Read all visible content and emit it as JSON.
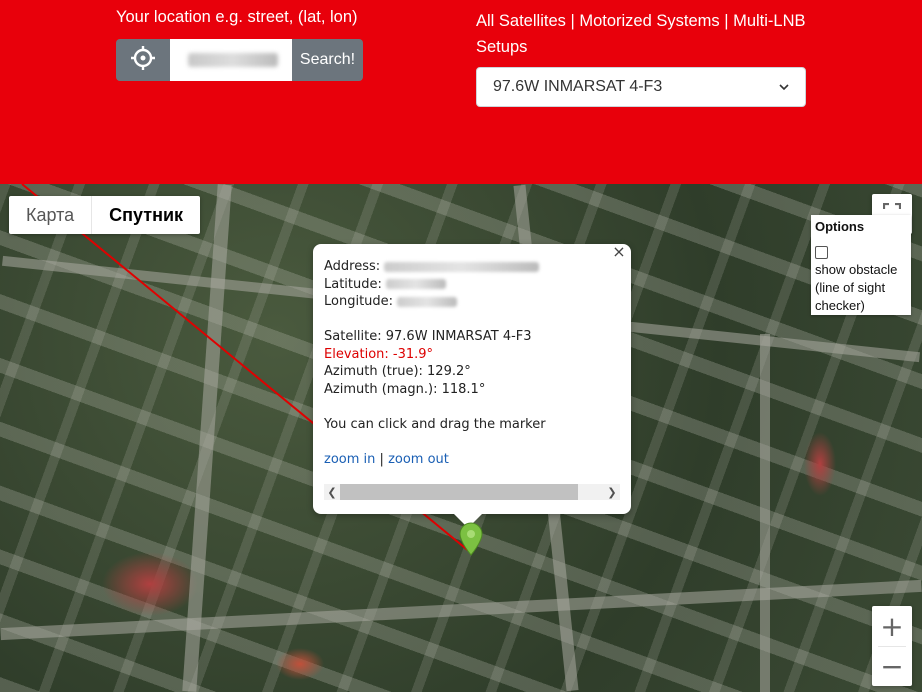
{
  "header": {
    "location_label": "Your location e.g. street, (lat, lon)",
    "search_placeholder": "",
    "search_button": "Search!",
    "satellite_links": "All Satellites | Motorized Systems | Multi-LNB Setups",
    "satellite_selected": "97.6W INMARSAT 4-F3",
    "colors": {
      "header_bg": "#e8000b",
      "button_bg": "#6c757d"
    }
  },
  "map": {
    "map_types": [
      "Карта",
      "Спутник"
    ],
    "active_map_type": "Спутник",
    "options": {
      "title": "Options",
      "checkbox_label": "show obstacle (line of sight checker)",
      "checked": false
    },
    "popup": {
      "address_label": "Address:",
      "latitude_label": "Latitude:",
      "longitude_label": "Longitude:",
      "satellite": "Satellite: 97.6W INMARSAT 4-F3",
      "elevation": "Elevation: -31.9°",
      "azimuth_true": "Azimuth (true): 129.2°",
      "azimuth_magn": "Azimuth (magn.): 118.1°",
      "drag_hint": "You can click and drag the marker",
      "zoom_in": "zoom in",
      "separator": "|",
      "zoom_out": "zoom out",
      "close": "×"
    },
    "zoom_controls": {
      "plus": "+",
      "minus": "−"
    },
    "icons": {
      "locate": "crosshair-icon",
      "fullscreen": "fullscreen-icon",
      "marker": "map-marker-icon",
      "select_arrow": "chevron-down-icon"
    },
    "colors": {
      "satellite_line": "#e00000",
      "marker": "#7cc142"
    }
  }
}
